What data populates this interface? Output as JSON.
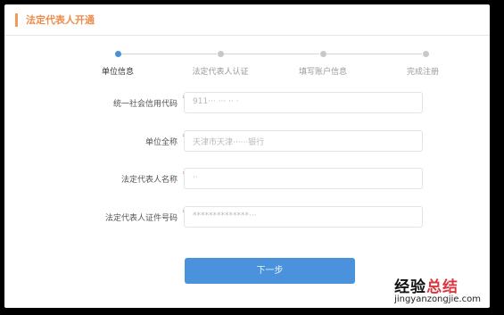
{
  "header": {
    "title": "法定代表人开通"
  },
  "steps": [
    {
      "label": "单位信息",
      "active": true
    },
    {
      "label": "法定代表人认证",
      "active": false
    },
    {
      "label": "填写账户信息",
      "active": false
    },
    {
      "label": "完成注册",
      "active": false
    }
  ],
  "form": {
    "fields": [
      {
        "label": "统一社会信用代码",
        "required_mark": "*",
        "value": "911··· ··· ·· ·"
      },
      {
        "label": "单位全称",
        "required_mark": "*",
        "value": "天津市天津······银行"
      },
      {
        "label": "法定代表人名称",
        "required_mark": "*",
        "value": "··"
      },
      {
        "label": "法定代表人证件号码",
        "required_mark": "*",
        "value": "**************···"
      }
    ]
  },
  "actions": {
    "next_label": "下一步"
  },
  "watermark": {
    "text_a": "经验",
    "text_b": "总结",
    "url": "jingyanzongjie.com"
  },
  "colors": {
    "accent_orange": "#ef8b4a",
    "primary_blue": "#4a93dc",
    "required_red": "#e0413b"
  }
}
